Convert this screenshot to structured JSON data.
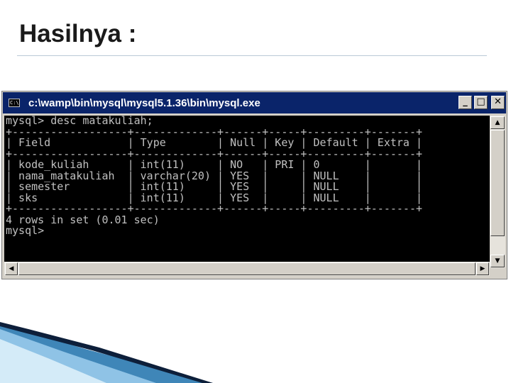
{
  "slide": {
    "title": "Hasilnya :"
  },
  "window": {
    "title": "c:\\wamp\\bin\\mysql\\mysql5.1.36\\bin\\mysql.exe",
    "app_icon_text": "C:\\",
    "controls": {
      "minimize": "_",
      "maximize": "□",
      "close": "✕"
    }
  },
  "console": {
    "lines": [
      "mysql> desc matakuliah;",
      "+------------------+-------------+------+-----+---------+-------+",
      "| Field            | Type        | Null | Key | Default | Extra |",
      "+------------------+-------------+------+-----+---------+-------+",
      "| kode_kuliah      | int(11)     | NO   | PRI | 0       |       |",
      "| nama_matakuliah  | varchar(20) | YES  |     | NULL    |       |",
      "| semester         | int(11)     | YES  |     | NULL    |       |",
      "| sks              | int(11)     | YES  |     | NULL    |       |",
      "+------------------+-------------+------+-----+---------+-------+",
      "4 rows in set (0.01 sec)",
      "",
      "mysql>"
    ]
  },
  "scrollbar": {
    "up": "▲",
    "down": "▼",
    "left": "◀",
    "right": "▶"
  },
  "colors": {
    "titlebar": "#0a246a",
    "console_bg": "#000000",
    "console_text": "#c0c0c0",
    "window_chrome": "#d4d0c8"
  }
}
